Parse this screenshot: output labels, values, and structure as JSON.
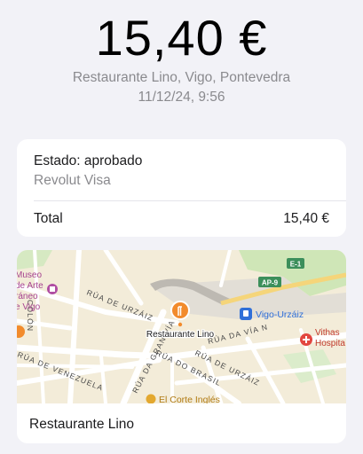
{
  "header": {
    "amount": "15,40 €",
    "merchant_location": "Restaurante Lino, Vigo, Pontevedra",
    "datetime": "11/12/24, 9:56"
  },
  "details": {
    "status": "Estado: aprobado",
    "card": "Revolut Visa",
    "total_label": "Total",
    "total_value": "15,40 €"
  },
  "map": {
    "place_name": "Restaurante Lino",
    "labels": {
      "museo_1": "Museo",
      "museo_2": "de Arte",
      "museo_3": "ráneo",
      "museo_4": "e Vigo",
      "colon": "COLÓN",
      "rua_urzaiz": "RÚA DE URZÁIZ",
      "rua_urzaiz_2": "RÚA DE URZÁIZ",
      "rua_via_n": "RÚA DA VÍA N",
      "rua_venezuela": "RÚA DE VENEZUELA",
      "rua_gran_via": "RÚA DA GRAN VÍA",
      "rua_brasil": "RÚA DO BRASIL",
      "restaurant_pin_label": "Restaurante Lino",
      "station": "Vigo-Urzáiz",
      "hospital_1": "Vithas",
      "hospital_2": "Hospita",
      "corte_ingles": "El Corte Inglés",
      "shield_ap9": "AP-9",
      "shield_e1": "E-1"
    },
    "colors": {
      "block": "#f3ecd9",
      "block_alt": "#f1e7cf",
      "street": "#ffffff",
      "park": "#cfe6b7",
      "rail": "#d9d6d0",
      "highway_shield": "#3c8f5b",
      "pin": "#f28b2c",
      "station": "#2f6fd8",
      "hospital": "#e2463f",
      "corte": "#e3a82f"
    }
  }
}
